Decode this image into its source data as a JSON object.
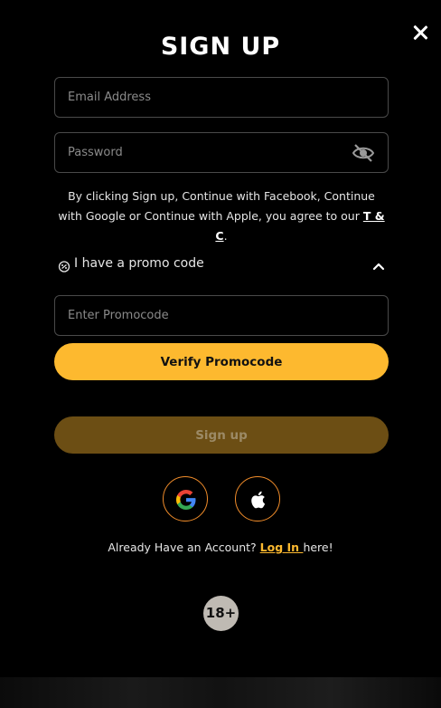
{
  "title": "SIGN UP",
  "close_icon": "close-icon",
  "email": {
    "placeholder": "Email Address",
    "value": ""
  },
  "password": {
    "placeholder": "Password",
    "value": "",
    "toggle_icon": "eye-off-icon"
  },
  "terms": {
    "text": "By clicking Sign up, Continue with Facebook, Continue with Google or Continue with Apple, you agree to our ",
    "link": "T & C",
    "suffix": "."
  },
  "promo": {
    "label": "I have a promo code",
    "icon": "promo-badge-icon",
    "expanded": true,
    "input_placeholder": "Enter Promocode",
    "verify_label": "Verify Promocode"
  },
  "signup_label": "Sign up",
  "social": [
    "google-icon",
    "apple-icon"
  ],
  "login": {
    "prefix": "Already Have an Account? ",
    "link": "Log In ",
    "suffix": "here!"
  },
  "age_badge": "18+",
  "colors": {
    "accent": "#fdb92f",
    "accent_dim": "#6c4e14",
    "social_border": "#f08c2a",
    "background": "#000000"
  }
}
